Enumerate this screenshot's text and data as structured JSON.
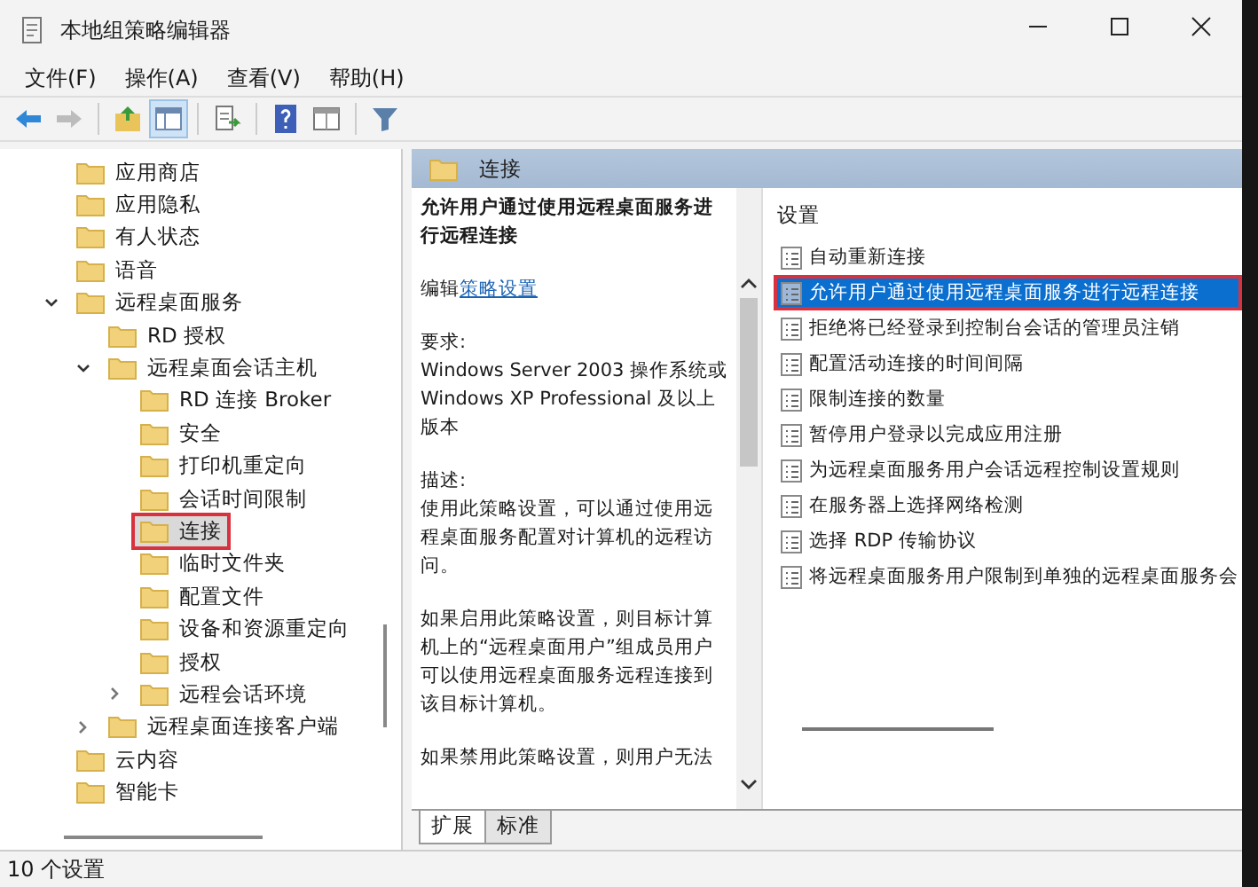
{
  "window": {
    "title": "本地组策略编辑器"
  },
  "menu": [
    "文件(F)",
    "操作(A)",
    "查看(V)",
    "帮助(H)"
  ],
  "toolbar": [
    {
      "kind": "back",
      "disabled": false,
      "selected": false
    },
    {
      "kind": "forward",
      "disabled": true,
      "selected": false
    },
    {
      "kind": "sep"
    },
    {
      "kind": "up",
      "disabled": false,
      "selected": false
    },
    {
      "kind": "pane",
      "disabled": false,
      "selected": true
    },
    {
      "kind": "sep"
    },
    {
      "kind": "export",
      "disabled": false,
      "selected": false
    },
    {
      "kind": "sep"
    },
    {
      "kind": "help",
      "disabled": false,
      "selected": false
    },
    {
      "kind": "view",
      "disabled": false,
      "selected": false
    },
    {
      "kind": "sep"
    },
    {
      "kind": "filter",
      "disabled": false,
      "selected": false
    }
  ],
  "tree": [
    {
      "label": "应用商店",
      "selected": false,
      "annotated": false
    },
    {
      "label": "应用隐私",
      "selected": false,
      "annotated": false
    },
    {
      "label": "有人状态",
      "selected": false,
      "annotated": false
    },
    {
      "label": "语音",
      "selected": false,
      "annotated": false
    },
    {
      "label": "远程桌面服务",
      "expanded": true,
      "selected": false,
      "annotated": false,
      "children": [
        {
          "label": "RD 授权",
          "selected": false,
          "annotated": false
        },
        {
          "label": "远程桌面会话主机",
          "expanded": true,
          "selected": false,
          "annotated": false,
          "children": [
            {
              "label": "RD 连接 Broker",
              "selected": false,
              "annotated": false
            },
            {
              "label": "安全",
              "selected": false,
              "annotated": false
            },
            {
              "label": "打印机重定向",
              "selected": false,
              "annotated": false
            },
            {
              "label": "会话时间限制",
              "selected": false,
              "annotated": false
            },
            {
              "label": "连接",
              "selected": true,
              "annotated": true
            },
            {
              "label": "临时文件夹",
              "selected": false,
              "annotated": false
            },
            {
              "label": "配置文件",
              "selected": false,
              "annotated": false
            },
            {
              "label": "设备和资源重定向",
              "selected": false,
              "annotated": false
            },
            {
              "label": "授权",
              "selected": false,
              "annotated": false
            },
            {
              "label": "远程会话环境",
              "expanded": false,
              "selected": false,
              "annotated": false
            }
          ]
        },
        {
          "label": "远程桌面连接客户端",
          "expanded": false,
          "selected": false,
          "annotated": false
        }
      ]
    },
    {
      "label": "云内容",
      "selected": false,
      "annotated": false
    },
    {
      "label": "智能卡",
      "selected": false,
      "annotated": false
    }
  ],
  "pane_header": "连接",
  "description": {
    "title": "允许用户通过使用远程桌面服务进行远程连接",
    "edit_prefix": "编辑",
    "edit_link": "策略设置",
    "blocks": [
      {
        "kind": "label",
        "text": "要求:"
      },
      {
        "kind": "text",
        "text": "Windows Server 2003 操作系统或 Windows XP Professional 及以上版本"
      },
      {
        "kind": "gap"
      },
      {
        "kind": "label",
        "text": "描述:"
      },
      {
        "kind": "text",
        "text": "使用此策略设置，可以通过使用远程桌面服务配置对计算机的远程访问。"
      },
      {
        "kind": "gap"
      },
      {
        "kind": "text",
        "text": "如果启用此策略设置，则目标计算机上的“远程桌面用户”组成员用户可以使用远程桌面服务远程连接到该目标计算机。"
      },
      {
        "kind": "gap"
      },
      {
        "kind": "text",
        "text": "如果禁用此策略设置，则用户无法"
      }
    ]
  },
  "settings": {
    "heading": "设置",
    "items": [
      {
        "label": "自动重新连接",
        "selected": false,
        "annotated": false
      },
      {
        "label": "允许用户通过使用远程桌面服务进行远程连接",
        "selected": true,
        "annotated": true
      },
      {
        "label": "拒绝将已经登录到控制台会话的管理员注销",
        "selected": false,
        "annotated": false
      },
      {
        "label": "配置活动连接的时间间隔",
        "selected": false,
        "annotated": false
      },
      {
        "label": "限制连接的数量",
        "selected": false,
        "annotated": false
      },
      {
        "label": "暂停用户登录以完成应用注册",
        "selected": false,
        "annotated": false
      },
      {
        "label": "为远程桌面服务用户会话远程控制设置规则",
        "selected": false,
        "annotated": false
      },
      {
        "label": "在服务器上选择网络检测",
        "selected": false,
        "annotated": false
      },
      {
        "label": "选择 RDP 传输协议",
        "selected": false,
        "annotated": false
      },
      {
        "label": "将远程桌面服务用户限制到单独的远程桌面服务会",
        "selected": false,
        "annotated": false
      }
    ]
  },
  "tabs": [
    {
      "label": "扩展",
      "selected": true
    },
    {
      "label": "标准",
      "selected": false
    }
  ],
  "status_bar": "10 个设置"
}
